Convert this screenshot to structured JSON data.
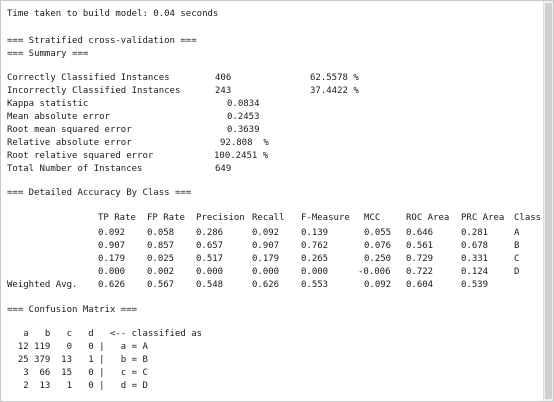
{
  "output": {
    "time_taken": "Time taken to build model: 0.04 seconds",
    "cv_header": "=== Stratified cross-validation ===",
    "summary_header": "=== Summary ===",
    "summary": [
      {
        "label": "Correctly Classified Instances",
        "value": "406",
        "pct": "62.5578 %"
      },
      {
        "label": "Incorrectly Classified Instances",
        "value": "243",
        "pct": "37.4422 %"
      },
      {
        "label": "Kappa statistic",
        "value": "0.0834"
      },
      {
        "label": "Mean absolute error",
        "value": "0.2453"
      },
      {
        "label": "Root mean squared error",
        "value": "0.3639"
      },
      {
        "label": "Relative absolute error",
        "value": "92.808  %"
      },
      {
        "label": "Root relative squared error",
        "value": "100.2451 %"
      },
      {
        "label": "Total Number of Instances",
        "value": "649"
      }
    ],
    "accuracy_header": "=== Detailed Accuracy By Class ===",
    "accuracy_columns": [
      "TP Rate",
      "FP Rate",
      "Precision",
      "Recall",
      "F-Measure",
      "MCC",
      "ROC Area",
      "PRC Area",
      "Class"
    ],
    "accuracy_rows": [
      {
        "label": "",
        "cells": [
          "0.092",
          "0.058",
          "0.286",
          "0.092",
          "0.139",
          "0.055",
          "0.646",
          "0.281",
          "A"
        ]
      },
      {
        "label": "",
        "cells": [
          "0.907",
          "0.857",
          "0.657",
          "0.907",
          "0.762",
          "0.076",
          "0.561",
          "0.678",
          "B"
        ]
      },
      {
        "label": "",
        "cells": [
          "0.179",
          "0.025",
          "0.517",
          "0.179",
          "0.265",
          "0.250",
          "0.729",
          "0.331",
          "C"
        ]
      },
      {
        "label": "",
        "cells": [
          "0.000",
          "0.002",
          "0.000",
          "0.000",
          "0.000",
          "-0.006",
          "0.722",
          "0.124",
          "D"
        ]
      },
      {
        "label": "Weighted Avg.",
        "cells": [
          "0.626",
          "0.567",
          "0.548",
          "0.626",
          "0.553",
          "0.092",
          "0.604",
          "0.539",
          ""
        ]
      }
    ],
    "confusion_header": "=== Confusion Matrix ===",
    "confusion_head": "   a   b   c   d   <-- classified as",
    "confusion_rows": [
      "  12 119   0   0 |   a = A",
      "  25 379  13   1 |   b = B",
      "   3  66  15   0 |   c = C",
      "   2  13   1   0 |   d = D"
    ]
  }
}
